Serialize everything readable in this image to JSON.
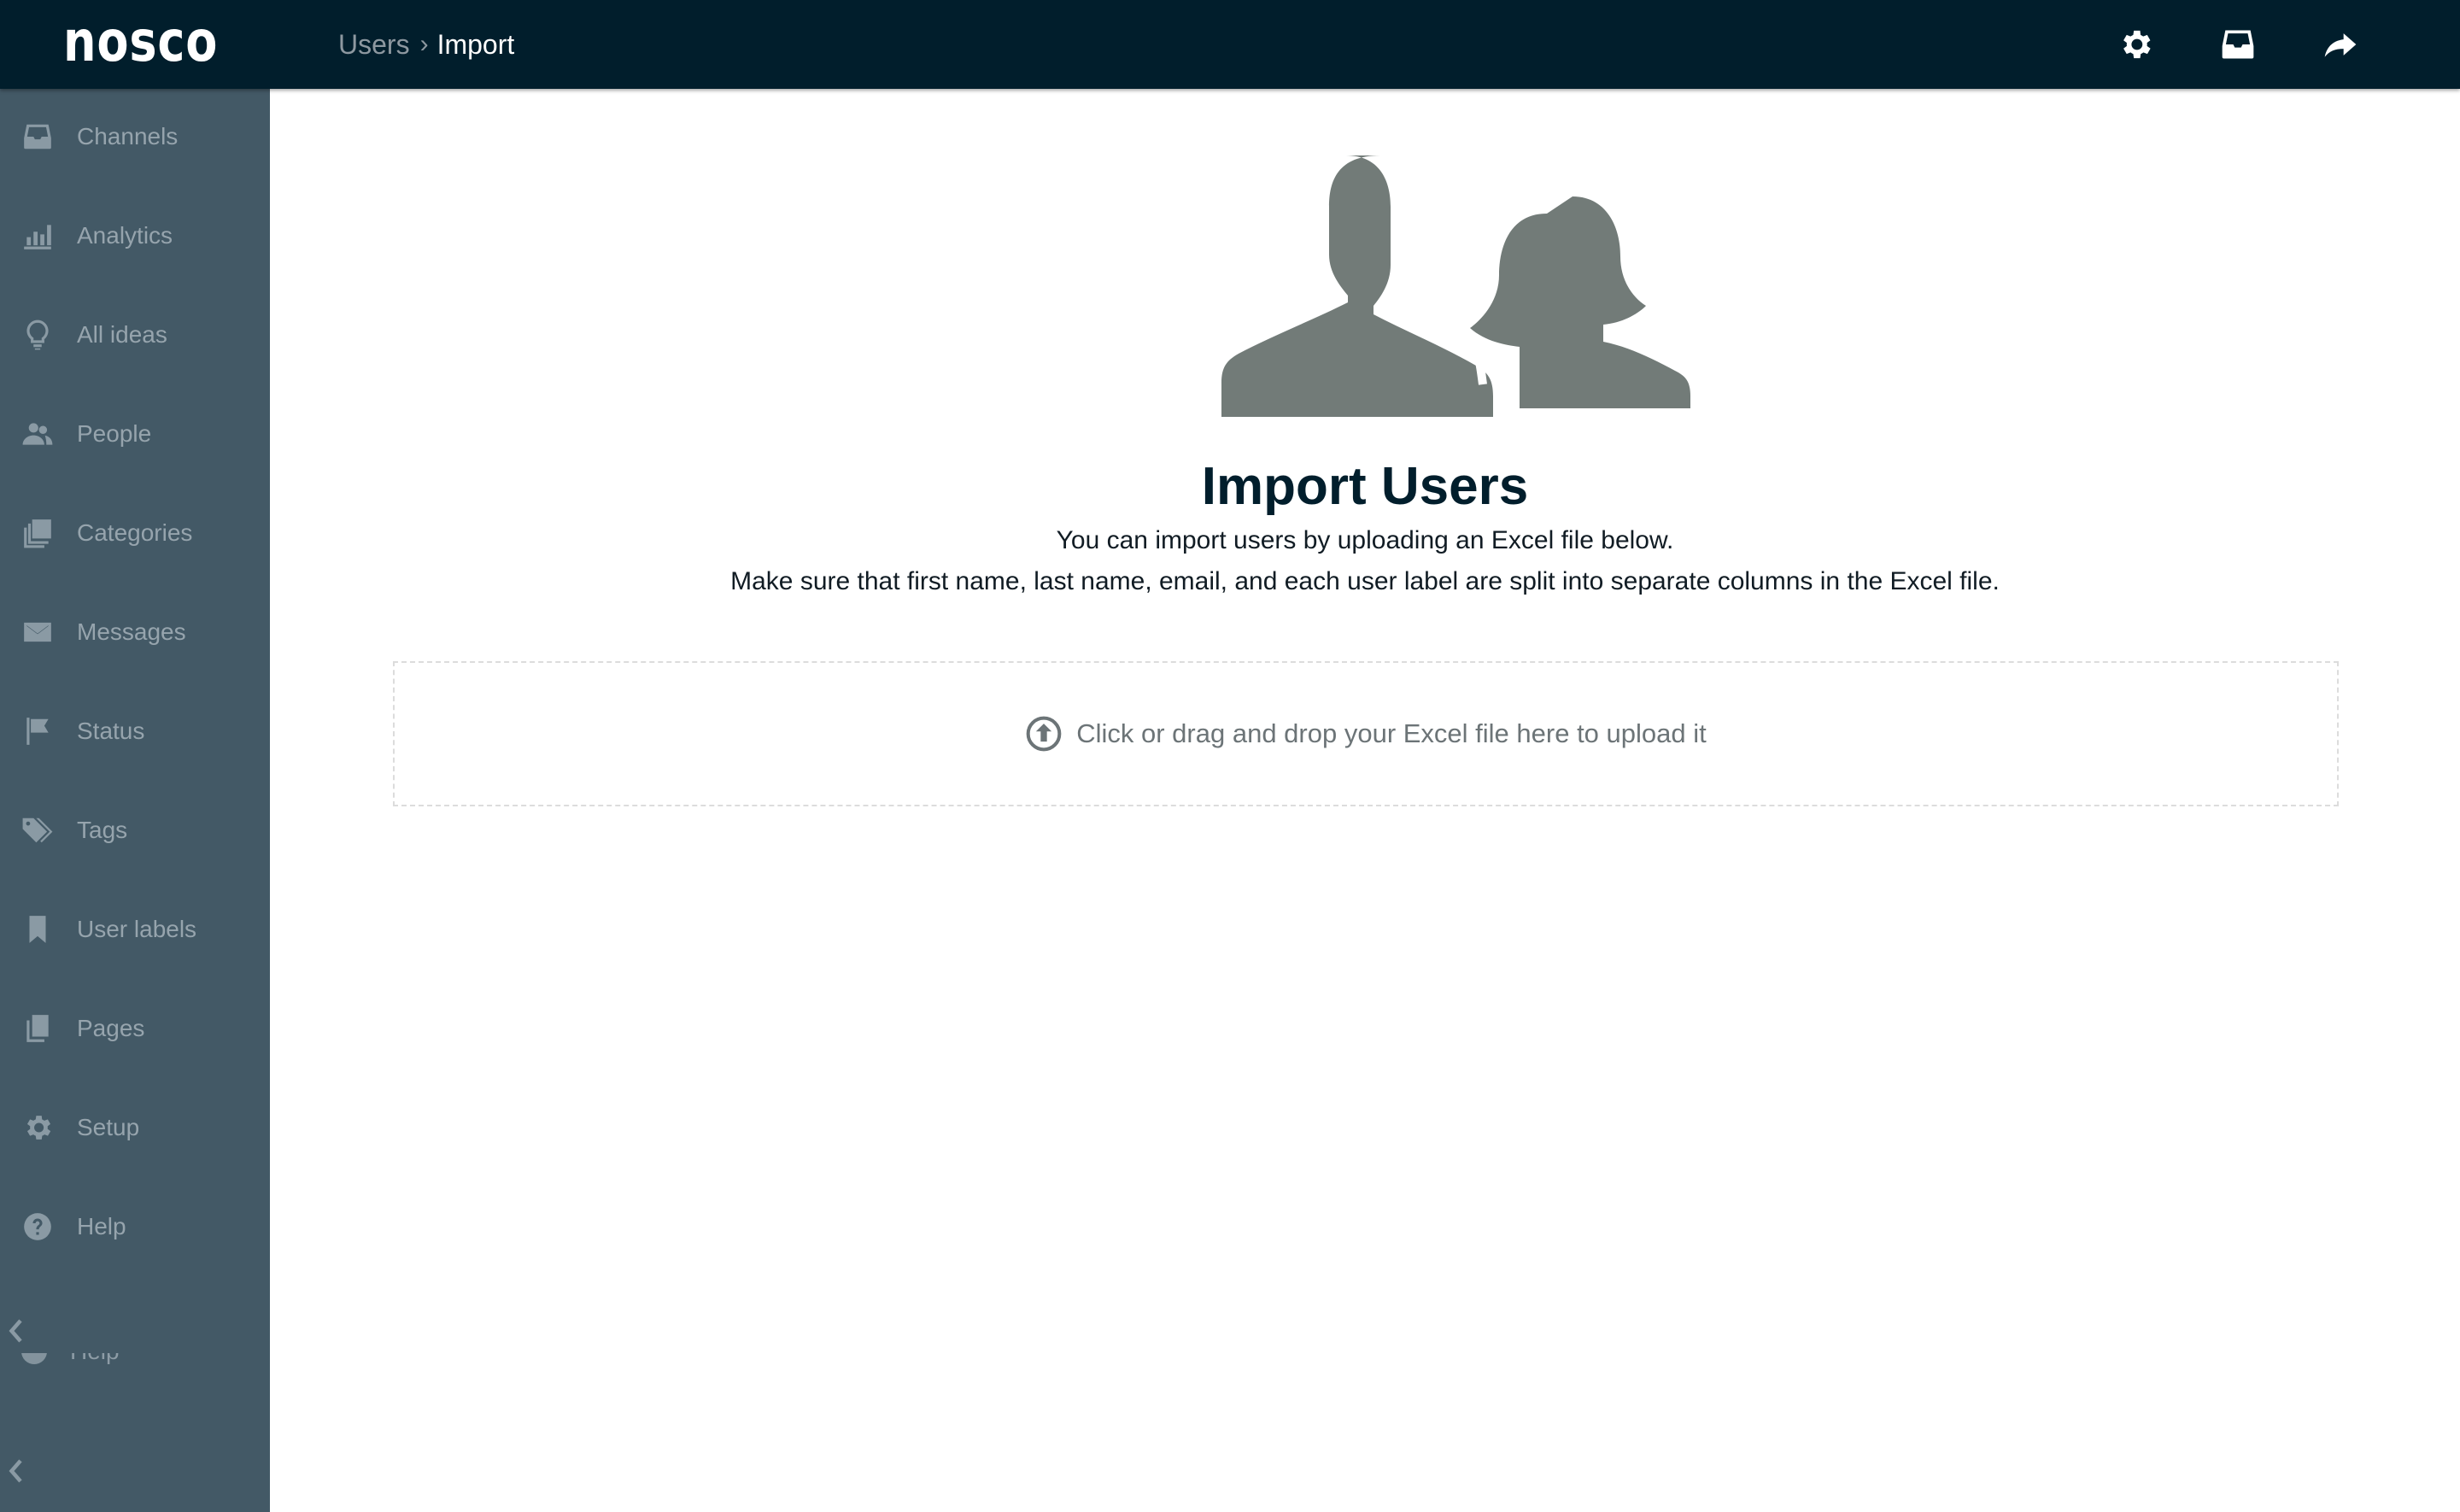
{
  "app": {
    "logo_text": "nosco"
  },
  "breadcrumb": {
    "parent": "Users",
    "separator": "›",
    "current": "Import"
  },
  "topbar_icons": [
    "gear-icon",
    "inbox-icon",
    "share-arrow-icon"
  ],
  "sidebar": {
    "items": [
      {
        "label": "Channels",
        "icon": "inbox-icon"
      },
      {
        "label": "Analytics",
        "icon": "bar-chart-icon"
      },
      {
        "label": "All ideas",
        "icon": "lightbulb-icon"
      },
      {
        "label": "People",
        "icon": "people-icon"
      },
      {
        "label": "Categories",
        "icon": "categories-icon"
      },
      {
        "label": "Messages",
        "icon": "envelope-icon"
      },
      {
        "label": "Status",
        "icon": "flag-icon"
      },
      {
        "label": "Tags",
        "icon": "tags-icon"
      },
      {
        "label": "User labels",
        "icon": "bookmark-icon"
      },
      {
        "label": "Pages",
        "icon": "pages-icon"
      },
      {
        "label": "Setup",
        "icon": "gear-icon"
      },
      {
        "label": "Help",
        "icon": "help-icon"
      }
    ],
    "ghost_label": "Help"
  },
  "main": {
    "title": "Import Users",
    "line1": "You can import users by uploading an Excel file below.",
    "line2": "Make sure that first name, last name, email, and each user label are split into separate columns in the Excel file.",
    "dropzone_text": "Click or drag and drop your Excel file here to upload it"
  },
  "colors": {
    "topbar": "#011e2c",
    "sidebar": "#435966",
    "sidebar_text": "#96a4ad",
    "hero_icon": "#727b78",
    "title": "#011e2c"
  }
}
